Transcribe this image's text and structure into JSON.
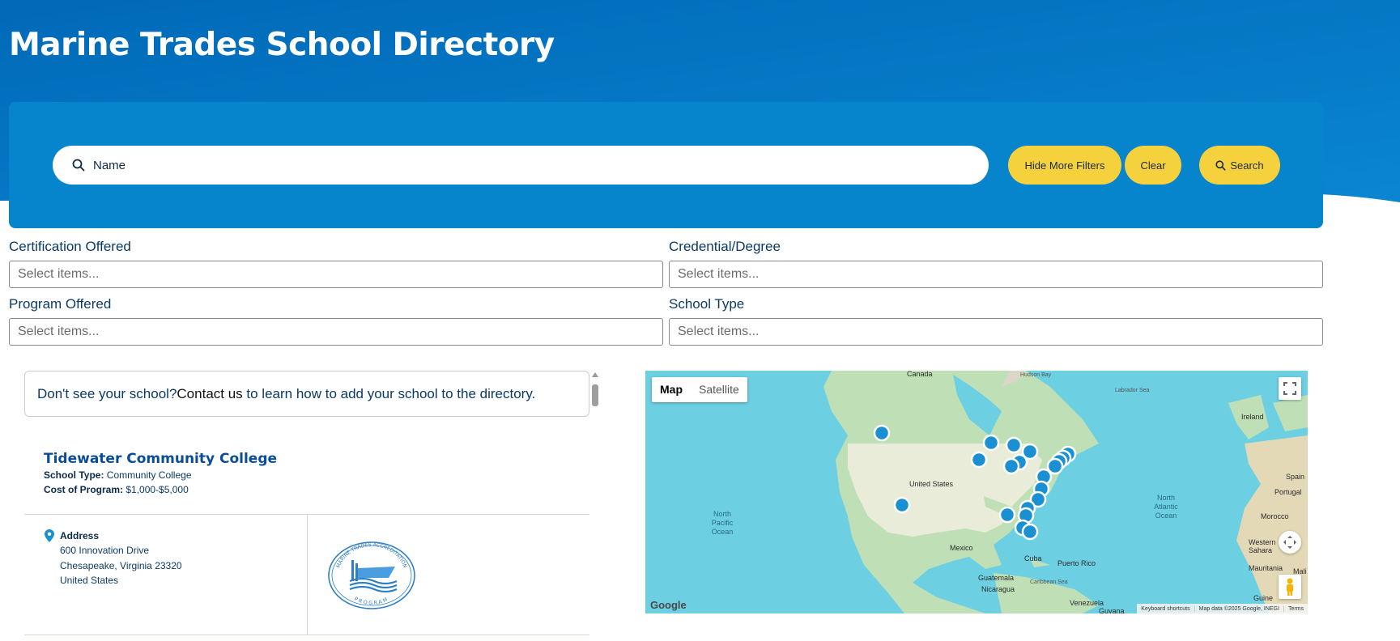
{
  "page": {
    "title": "Marine Trades School Directory"
  },
  "search": {
    "placeholder": "Name",
    "more_filters_label": "Hide More Filters",
    "clear_label": "Clear",
    "search_label": "Search"
  },
  "filters": [
    {
      "label": "Certification Offered",
      "placeholder": "Select items..."
    },
    {
      "label": "Credential/Degree",
      "placeholder": "Select items..."
    },
    {
      "label": "Program Offered",
      "placeholder": "Select items..."
    },
    {
      "label": "School Type",
      "placeholder": "Select items..."
    }
  ],
  "notice": {
    "before": "Don't see your school? ",
    "link": "Contact us",
    "after": " to learn how to add your school to the directory."
  },
  "school": {
    "name": "Tidewater Community College",
    "type_label": "School Type:",
    "type_value": " Community College",
    "cost_label": "Cost of Program:",
    "cost_value": " $1,000-$5,000",
    "address_heading": "Address",
    "address_lines": [
      "600 Innovation Drive",
      "Chesapeake, Virginia 23320",
      "United States"
    ],
    "logo_text_top": "MARINE TRADES ACCREDITATION",
    "logo_text_bottom": "PROGRAM"
  },
  "map": {
    "map_button": "Map",
    "satellite_button": "Satellite",
    "labels": {
      "canada": "Canada",
      "hudson_bay": "Hudson Bay",
      "labrador_sea": "Labrador Sea",
      "ireland": "Ireland",
      "united_states": "United States",
      "north_pacific": "North Pacific Ocean",
      "north_atlantic": "North Atlantic Ocean",
      "spain": "Spain",
      "portugal": "Portugal",
      "morocco": "Morocco",
      "western_sahara": "Western Sahara",
      "mauritania": "Mauritania",
      "mali": "Mali",
      "mexico": "Mexico",
      "cuba": "Cuba",
      "puerto_rico": "Puerto Rico",
      "guatemala": "Guatemala",
      "nicaragua": "Nicaragua",
      "caribbean_sea": "Caribbean Sea",
      "venezuela": "Venezuela",
      "guyana": "Guyana",
      "guinea": "Guine"
    },
    "attribution": [
      "Keyboard shortcuts",
      "Map data ©2025 Google, INEGI",
      "Terms"
    ],
    "google_logo": "Google"
  },
  "colors": {
    "brand_blue": "#0070bf",
    "panel_blue": "#0684cc",
    "accent_yellow": "#f5d13e",
    "marker_blue": "#1a8fd1"
  }
}
